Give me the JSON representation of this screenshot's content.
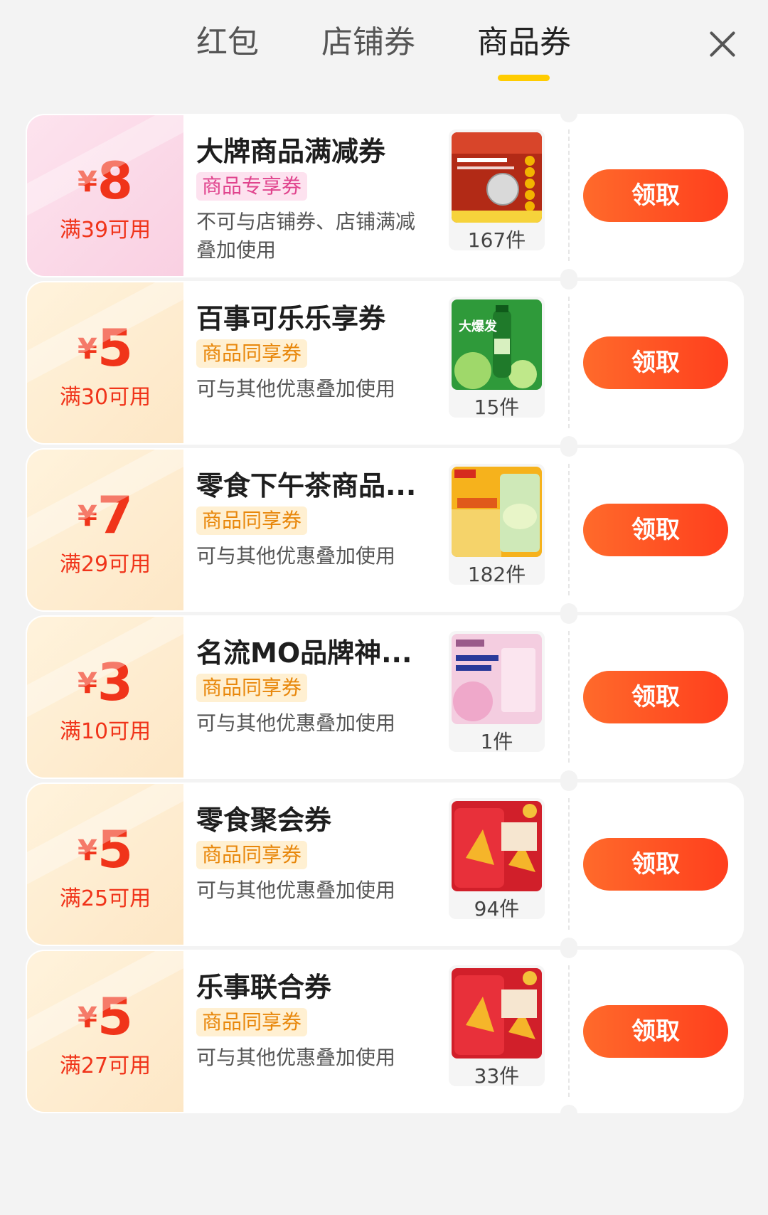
{
  "tabs": [
    {
      "label": "红包",
      "active": false
    },
    {
      "label": "店铺券",
      "active": false
    },
    {
      "label": "商品券",
      "active": true
    }
  ],
  "colors": {
    "accent": "#ff4a1f",
    "tab_indicator": "#ffcc00",
    "amount": "#f0341a"
  },
  "coupons": [
    {
      "amount": "8",
      "currency": "¥",
      "threshold": "满39可用",
      "title": "大牌商品满减券",
      "badge": "商品专享券",
      "desc": "不可与店铺券、店铺满减叠加使用",
      "count": "167件",
      "button": "领取",
      "theme": "pink"
    },
    {
      "amount": "5",
      "currency": "¥",
      "threshold": "满30可用",
      "title": "百事可乐乐享券",
      "badge": "商品同享券",
      "desc": "可与其他优惠叠加使用",
      "count": "15件",
      "button": "领取",
      "theme": "orange"
    },
    {
      "amount": "7",
      "currency": "¥",
      "threshold": "满29可用",
      "title": "零食下午茶商品...",
      "badge": "商品同享券",
      "desc": "可与其他优惠叠加使用",
      "count": "182件",
      "button": "领取",
      "theme": "orange"
    },
    {
      "amount": "3",
      "currency": "¥",
      "threshold": "满10可用",
      "title": "名流MO品牌神...",
      "badge": "商品同享券",
      "desc": "可与其他优惠叠加使用",
      "count": "1件",
      "button": "领取",
      "theme": "orange"
    },
    {
      "amount": "5",
      "currency": "¥",
      "threshold": "满25可用",
      "title": "零食聚会券",
      "badge": "商品同享券",
      "desc": "可与其他优惠叠加使用",
      "count": "94件",
      "button": "领取",
      "theme": "orange"
    },
    {
      "amount": "5",
      "currency": "¥",
      "threshold": "满27可用",
      "title": "乐事联合券",
      "badge": "商品同享券",
      "desc": "可与其他优惠叠加使用",
      "count": "33件",
      "button": "领取",
      "theme": "orange"
    }
  ],
  "product_images": [
    "battery",
    "soda",
    "chips-green",
    "pink-pack",
    "chips-red",
    "chips-red"
  ]
}
